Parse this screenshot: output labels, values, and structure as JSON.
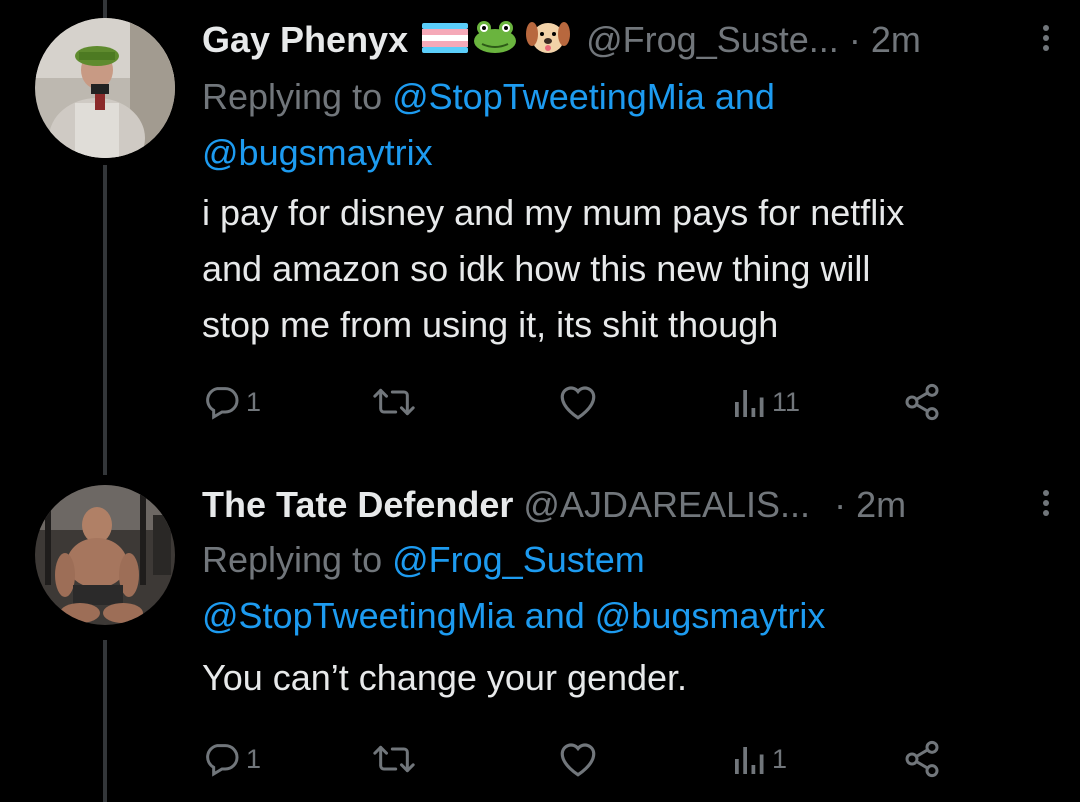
{
  "tweets": [
    {
      "name": "Gay Phenyx",
      "emoji": [
        "trans-flag",
        "frog-face",
        "dog-face"
      ],
      "handle": "@Frog_Suste...",
      "dot": "·",
      "time": "2m",
      "replying_prefix": "Replying to ",
      "reply_line1_mention": "@StopTweetingMia",
      "reply_line1_and": " and",
      "reply_line2_mention": "@bugsmaytrix",
      "text_lines": [
        "i pay for disney and my mum pays for netflix",
        "and amazon so idk how this new thing will",
        "stop me from using it, its shit though"
      ],
      "reply_count": "1",
      "views": "11"
    },
    {
      "name": "The Tate Defender",
      "handle": "@AJDAREALIS...",
      "dot": "·",
      "time": "2m",
      "replying_prefix": "Replying to ",
      "reply_line1_mention": "@Frog_Sustem",
      "reply_line2_mention_a": "@StopTweetingMia",
      "reply_line2_and": " and ",
      "reply_line2_mention_b": "@bugsmaytrix",
      "text_lines": [
        "You can’t change your gender."
      ],
      "reply_count": "1",
      "views": "1"
    }
  ],
  "colors": {
    "background": "#000000",
    "text": "#e7e9ea",
    "muted": "#71767b",
    "link": "#1d9bf0"
  }
}
